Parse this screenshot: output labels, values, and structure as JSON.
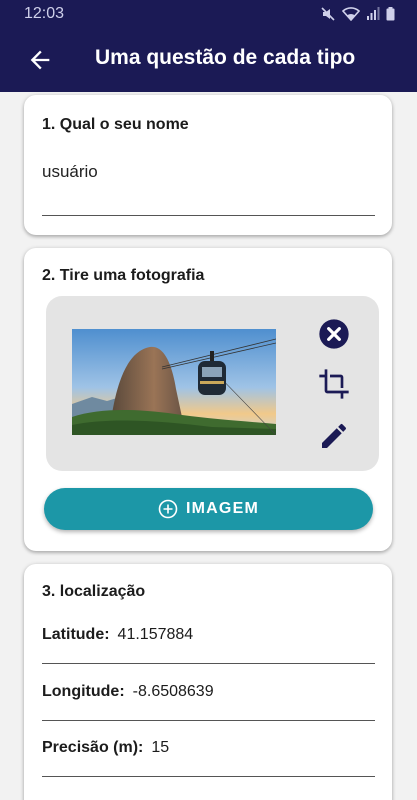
{
  "status": {
    "time": "12:03"
  },
  "appbar": {
    "title": "Uma questão de cada tipo"
  },
  "q1": {
    "title": "1. Qual o seu nome",
    "answer": "usuário"
  },
  "q2": {
    "title": "2. Tire uma fotografia",
    "button_label": "IMAGEM"
  },
  "q3": {
    "title": "3. localização",
    "latitude_label": "Latitude:",
    "latitude_value": "41.157884",
    "longitude_label": "Longitude:",
    "longitude_value": "-8.6508639",
    "precision_label": "Precisão (m):",
    "precision_value": "15"
  },
  "colors": {
    "appbar": "#1b1a55",
    "accent": "#1c97a7",
    "icon": "#1b1a55"
  }
}
